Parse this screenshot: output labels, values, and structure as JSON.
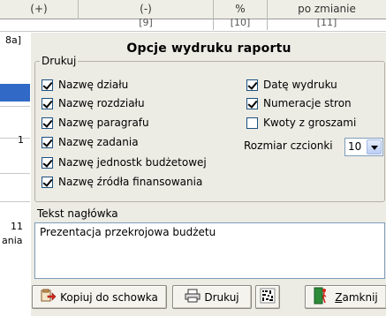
{
  "background": {
    "header_cells": [
      "(+)",
      "(-)",
      "%",
      "po zmianie"
    ],
    "subheader_cells": [
      "[9]",
      "[10]",
      "[11]"
    ],
    "left_cells": [
      "8a]",
      "1",
      "11",
      "ania"
    ]
  },
  "dialog": {
    "title": "Opcje wydruku raportu",
    "drukuj": {
      "legend": "Drukuj",
      "left_options": [
        {
          "label": "Nazwę działu",
          "checked": true
        },
        {
          "label": "Nazwę rozdziału",
          "checked": true
        },
        {
          "label": "Nazwę paragrafu",
          "checked": true
        },
        {
          "label": "Nazwę zadania",
          "checked": true
        },
        {
          "label": "Nazwę jednostk budżetowej",
          "checked": true
        },
        {
          "label": "Nazwę źródła finansowania",
          "checked": true
        }
      ],
      "right_options": [
        {
          "label": "Datę wydruku",
          "checked": true
        },
        {
          "label": "Numeracje stron",
          "checked": true
        },
        {
          "label": "Kwoty z groszami",
          "checked": false
        }
      ],
      "font_size_label": "Rozmiar czcionki",
      "font_size_value": "10"
    },
    "header_text": {
      "legend": "Tekst nagłówka",
      "value": "Prezentacja przekrojowa budżetu"
    },
    "buttons": {
      "copy_label": "Kopiuj do schowka",
      "print_label": "Drukuj",
      "close_prefix": "Z",
      "close_rest": "amknij"
    },
    "icons": {
      "copy": "clipboard-arrow-icon",
      "print": "printer-icon",
      "barcode": "barcode-icon",
      "close": "door-exit-icon"
    }
  }
}
